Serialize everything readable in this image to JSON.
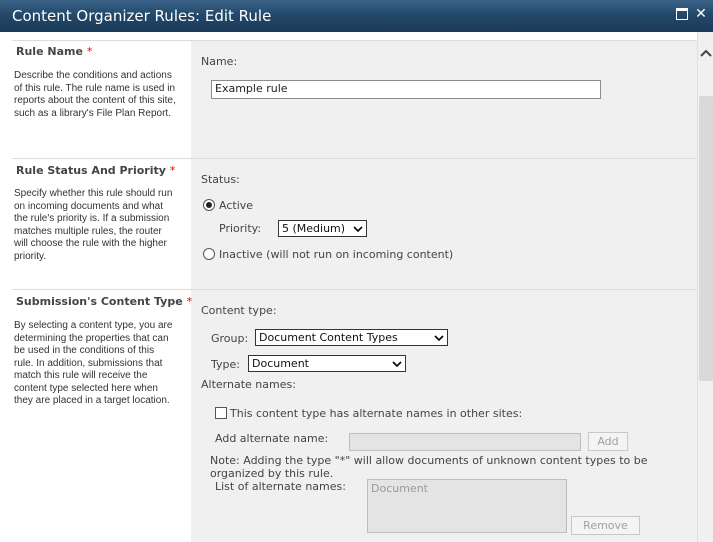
{
  "dialog": {
    "title": "Content Organizer Rules: Edit Rule"
  },
  "sections": {
    "rule_name": {
      "title": "Rule Name",
      "required_mark": "*",
      "description": "Describe the conditions and actions of this rule. The rule name is used in reports about the content of this site, such as a library's File Plan Report.",
      "name_label": "Name:",
      "name_value": "Example rule"
    },
    "status": {
      "title": "Rule Status And Priority",
      "required_mark": "*",
      "description": "Specify whether this rule should run on incoming documents and what the rule's priority is. If a submission matches multiple rules, the router will choose the rule with the higher priority.",
      "status_label": "Status:",
      "active_label": "Active",
      "active_selected": true,
      "priority_label": "Priority:",
      "priority_value": "5 (Medium)",
      "inactive_label": "Inactive (will not run on incoming content)"
    },
    "content_type": {
      "title": "Submission's Content Type",
      "required_mark": "*",
      "description": "By selecting a content type, you are determining the properties that can be used in the conditions of this rule. In addition, submissions that match this rule will receive the content type selected here when they are placed in a target location.",
      "content_type_label": "Content type:",
      "group_label": "Group:",
      "group_value": "Document Content Types",
      "type_label": "Type:",
      "type_value": "Document",
      "alternate_names_label": "Alternate names:",
      "alt_checkbox_label": "This content type has alternate names in other sites:",
      "alt_checkbox_checked": false,
      "add_alt_label": "Add alternate name:",
      "add_button": "Add",
      "note": "Note: Adding the type \"*\" will allow documents of unknown content types to be organized by this rule.",
      "list_label": "List of alternate names:",
      "list_items": [
        "Document"
      ],
      "remove_button": "Remove"
    }
  },
  "colors": {
    "titlebar": "#23486a",
    "required": "#e60000",
    "panel": "#f0f0f0"
  }
}
